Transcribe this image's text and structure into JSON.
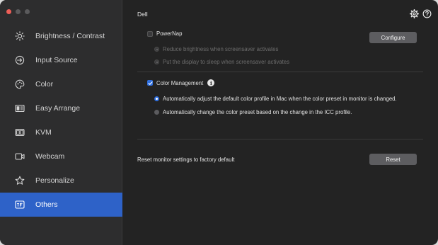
{
  "app": {
    "brand": "Dell"
  },
  "sidebar": {
    "items": [
      {
        "label": "Brightness / Contrast",
        "icon": "sun-icon",
        "active": false
      },
      {
        "label": "Input Source",
        "icon": "input-source-icon",
        "active": false
      },
      {
        "label": "Color",
        "icon": "color-palette-icon",
        "active": false
      },
      {
        "label": "Easy Arrange",
        "icon": "easy-arrange-icon",
        "active": false
      },
      {
        "label": "KVM",
        "icon": "kvm-icon",
        "active": false
      },
      {
        "label": "Webcam",
        "icon": "webcam-icon",
        "active": false
      },
      {
        "label": "Personalize",
        "icon": "star-icon",
        "active": false
      },
      {
        "label": "Others",
        "icon": "others-icon",
        "active": true
      }
    ]
  },
  "powernap": {
    "label": "PowerNap",
    "checked": false,
    "configure_label": "Configure",
    "options": [
      {
        "label": "Reduce brightness when screensaver activates",
        "selected": true,
        "enabled": false
      },
      {
        "label": "Put the display to sleep when screensaver activates",
        "selected": false,
        "enabled": false
      }
    ]
  },
  "color_management": {
    "label": "Color Management",
    "checked": true,
    "options": [
      {
        "label": "Automatically adjust the default color profile in Mac when the color preset in monitor is changed.",
        "selected": true
      },
      {
        "label": "Automatically change the color preset based on the change in the ICC profile.",
        "selected": false
      }
    ]
  },
  "reset": {
    "description": "Reset monitor settings to factory default",
    "button_label": "Reset"
  },
  "colors": {
    "accent": "#2e62c8",
    "sidebar_bg": "#2d2d2e",
    "main_bg": "#232323"
  }
}
